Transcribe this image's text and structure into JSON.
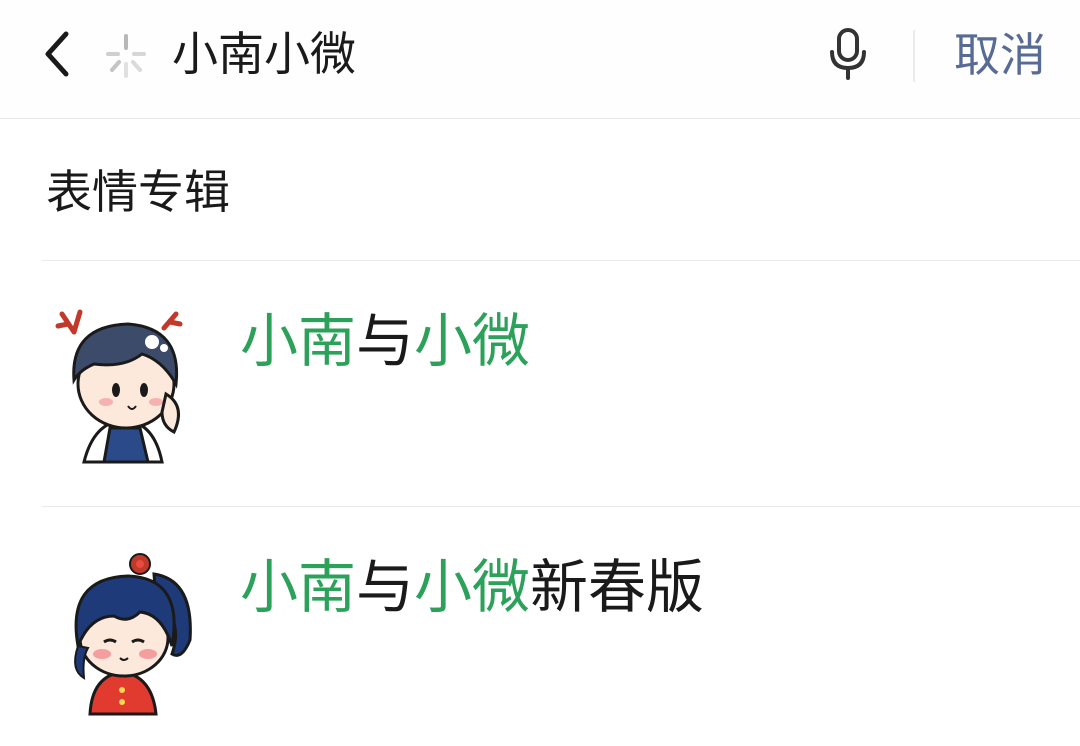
{
  "header": {
    "back_icon": "chevron-left-icon",
    "loading_icon": "loading-spinner-icon",
    "search_value": "小南小微",
    "mic_icon": "microphone-icon",
    "cancel_label": "取消"
  },
  "section": {
    "title": "表情专辑"
  },
  "results": [
    {
      "title_parts": [
        {
          "text": "小南",
          "highlight": true
        },
        {
          "text": "与",
          "highlight": false
        },
        {
          "text": "小微",
          "highlight": true
        }
      ],
      "thumbnail": "boy-sticker-thumbnail"
    },
    {
      "title_parts": [
        {
          "text": "小南",
          "highlight": true
        },
        {
          "text": "与",
          "highlight": false
        },
        {
          "text": "小微",
          "highlight": true
        },
        {
          "text": "新春版",
          "highlight": false
        }
      ],
      "thumbnail": "girl-sticker-thumbnail"
    }
  ],
  "colors": {
    "highlight": "#2ca15a",
    "cancel": "#576b95",
    "text": "#1a1a1a"
  }
}
